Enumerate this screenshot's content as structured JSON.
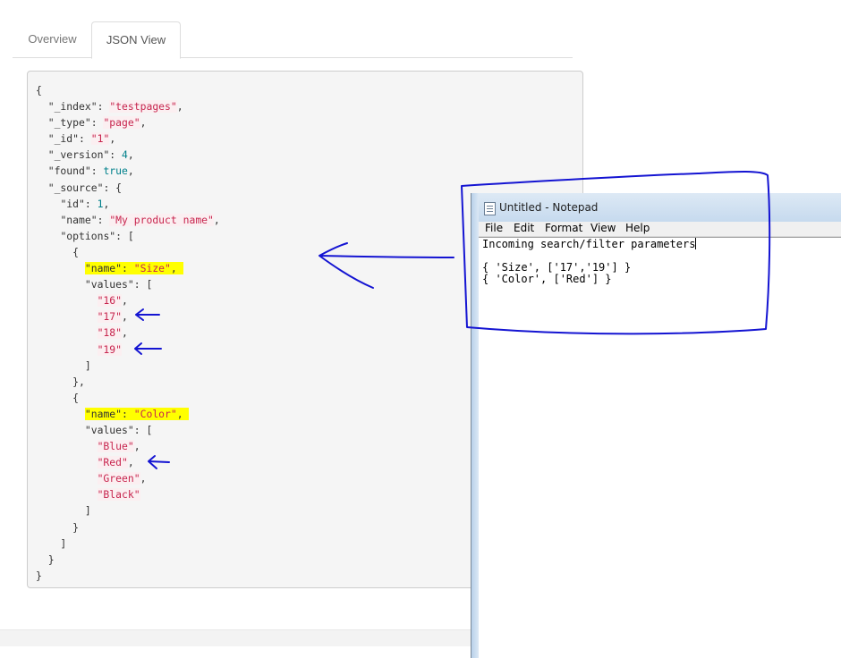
{
  "tabs": [
    {
      "label": "Overview",
      "active": false
    },
    {
      "label": "JSON View",
      "active": true
    }
  ],
  "json_view": {
    "index_key": "\"_index\"",
    "index_val": "\"testpages\"",
    "type_key": "\"_type\"",
    "type_val": "\"page\"",
    "id_key": "\"_id\"",
    "id_val": "\"1\"",
    "version_key": "\"_version\"",
    "version_val": "4",
    "found_key": "\"found\"",
    "found_val": "true",
    "source_key": "\"_source\"",
    "src_id_key": "\"id\"",
    "src_id_val": "1",
    "src_name_key": "\"name\"",
    "src_name_val": "\"My product name\"",
    "options_key": "\"options\"",
    "opt1_name_key": "\"name\"",
    "opt1_name_val": "\"Size\"",
    "values_key": "\"values\"",
    "size_values": [
      "\"16\"",
      "\"17\"",
      "\"18\"",
      "\"19\""
    ],
    "opt2_name_key": "\"name\"",
    "opt2_name_val": "\"Color\"",
    "color_values": [
      "\"Blue\"",
      "\"Red\"",
      "\"Green\"",
      "\"Black\""
    ]
  },
  "notepad": {
    "title": "Untitled - Notepad",
    "menu": [
      "File",
      "Edit",
      "Format",
      "View",
      "Help"
    ],
    "line1": "Incoming search/filter parameters",
    "line2": "{ 'Size', ['17','19'] }",
    "line3": "{ 'Color', ['Red'] }"
  },
  "colors": {
    "annotation_ink": "#1414d2",
    "highlight": "#ffff00",
    "string": "#c7254e",
    "number": "#00808b"
  }
}
